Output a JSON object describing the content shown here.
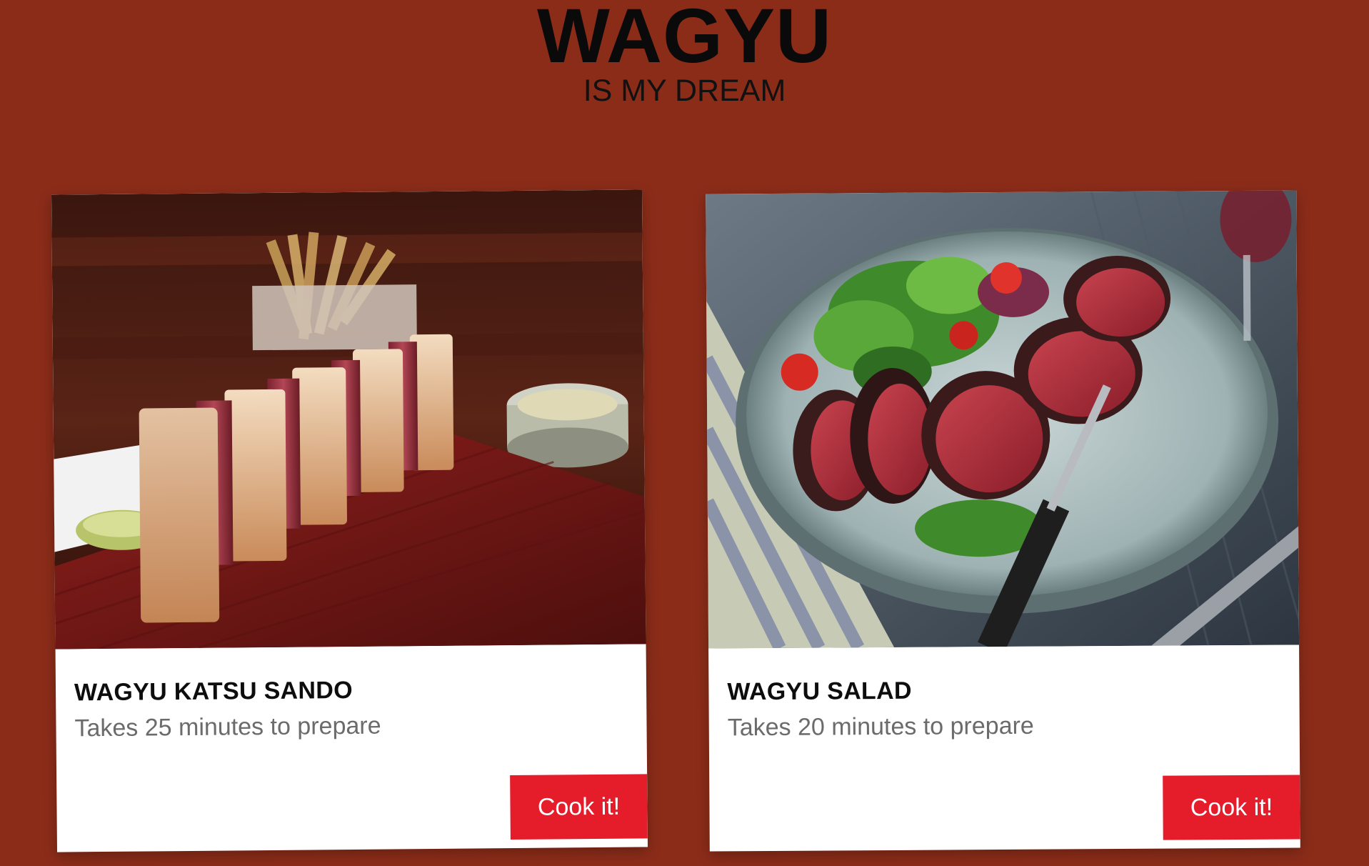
{
  "header": {
    "title": "WAGYU",
    "subtitle": "IS MY DREAM"
  },
  "colors": {
    "background": "#8b2c19",
    "card": "#ffffff",
    "button": "#e51c2a",
    "title_text": "#0a0a0a",
    "meta_text": "#6b6b6b"
  },
  "recipes": [
    {
      "name": "WAGYU KATSU SANDO",
      "time": "Takes 25 minutes to prepare",
      "button_label": "Cook it!",
      "image": "wagyu-katsu-sando-photo"
    },
    {
      "name": "WAGYU SALAD",
      "time": "Takes 20 minutes to prepare",
      "button_label": "Cook it!",
      "image": "wagyu-salad-photo"
    }
  ]
}
